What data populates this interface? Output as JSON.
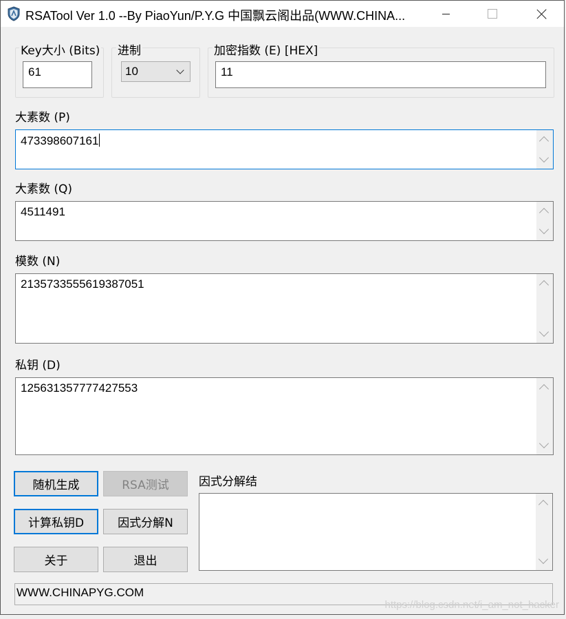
{
  "window": {
    "title": "RSATool Ver 1.0 --By PiaoYun/P.Y.G 中国飘云阁出品(WWW.CHINA..."
  },
  "keysize": {
    "label": "Key大小 (Bits)",
    "value": "61"
  },
  "radix": {
    "label": "进制",
    "selected": "10"
  },
  "exponent": {
    "label": "加密指数 (E) [HEX]",
    "value": "11"
  },
  "prime_p": {
    "label": "大素数 (P)",
    "value": "473398607161"
  },
  "prime_q": {
    "label": "大素数 (Q)",
    "value": "4511491"
  },
  "modulus": {
    "label": "模数 (N)",
    "value": "2135733555619387051"
  },
  "private_key": {
    "label": "私钥 (D)",
    "value": "125631357777427553"
  },
  "buttons": {
    "random": "随机生成",
    "rsa_test": "RSA测试",
    "calc_d": "计算私钥D",
    "factor_n": "因式分解N",
    "about": "关于",
    "exit": "退出"
  },
  "factor_result": {
    "label": "因式分解结",
    "value": ""
  },
  "status": {
    "text": "WWW.CHINAPYG.COM"
  },
  "watermark": "https://blog.csdn.net/i_am_not_hacker",
  "colors": {
    "focus": "#0078d7",
    "button": "#e1e1e1",
    "window": "#f0f0f0"
  },
  "icons": [
    "app-shield-icon",
    "minimize-icon",
    "maximize-icon",
    "close-icon",
    "scroll-up-icon",
    "scroll-down-icon",
    "chevron-down-icon"
  ]
}
